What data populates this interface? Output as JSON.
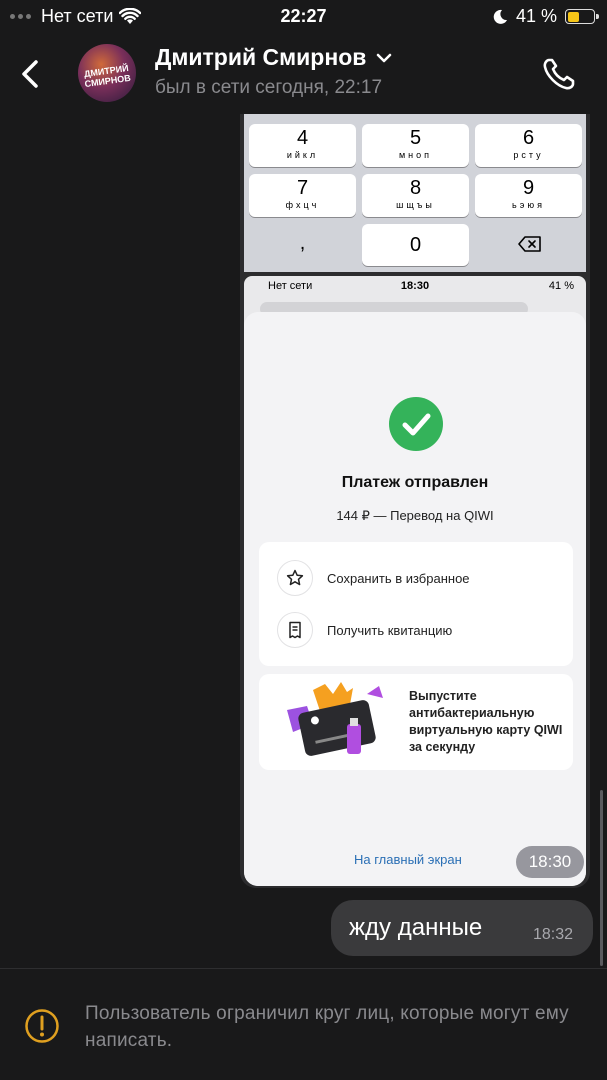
{
  "status_bar": {
    "carrier": "Нет сети",
    "time": "22:27",
    "battery": "41 %",
    "battery_level": 0.41
  },
  "header": {
    "contact_name": "Дмитрий Смирнов",
    "last_seen": "был в сети сегодня, 22:17",
    "avatar_text": "ДМИТРИЙ СМИРНОВ"
  },
  "screenshot": {
    "keypad": [
      {
        "num": "4",
        "letters": "ийкл"
      },
      {
        "num": "5",
        "letters": "мноп"
      },
      {
        "num": "6",
        "letters": "рсту"
      },
      {
        "num": "7",
        "letters": "фхцч"
      },
      {
        "num": "8",
        "letters": "шщъы"
      },
      {
        "num": "9",
        "letters": "ьэюя"
      },
      {
        "num": ",",
        "letters": ""
      },
      {
        "num": "0",
        "letters": ""
      }
    ],
    "status": {
      "carrier": "Нет сети",
      "time": "18:30",
      "battery": "41 %"
    },
    "title": "Платеж отправлен",
    "subtitle": "144 ₽ — Перевод на QIWI",
    "actions": [
      {
        "label": "Сохранить в избранное",
        "icon": "star-icon"
      },
      {
        "label": "Получить квитанцию",
        "icon": "receipt-icon"
      }
    ],
    "promo": "Выпустите антибактериальную виртуальную карту QIWI за секунду",
    "home_link": "На главный экран",
    "sent_time": "18:30"
  },
  "message": {
    "text": "жду данные",
    "time": "18:32"
  },
  "footer": {
    "notice": "Пользователь ограничил круг лиц, которые могут ему написать."
  },
  "colors": {
    "background": "#19191a",
    "bubble": "#3a3a3c",
    "accent_warning": "#e0a020",
    "success": "#34b35a",
    "link": "#2a6fb5"
  }
}
